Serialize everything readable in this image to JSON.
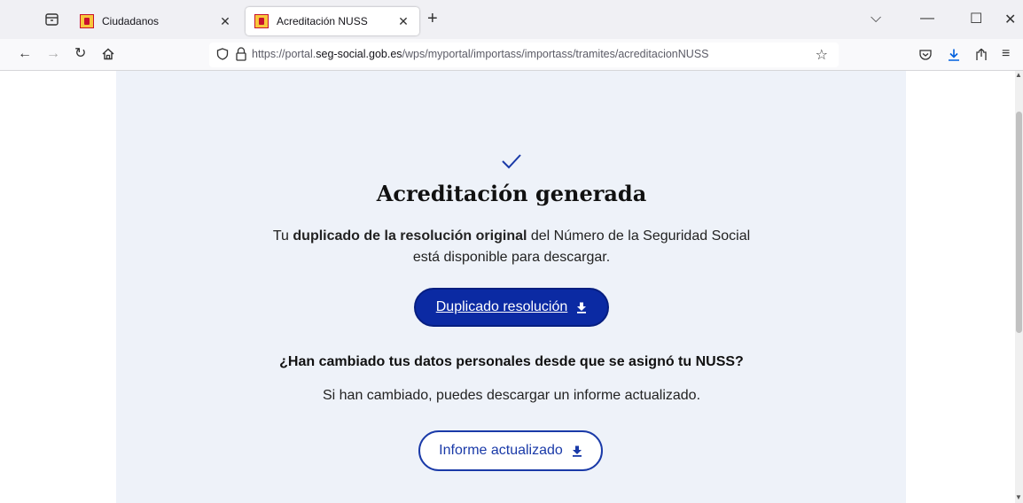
{
  "browser": {
    "tabs": [
      {
        "label": "Ciudadanos",
        "active": false
      },
      {
        "label": "Acreditación NUSS",
        "active": true
      }
    ],
    "url": {
      "prefix": "https://portal.",
      "host": "seg-social.gob.es",
      "path": "/wps/myportal/importass/importass/tramites/acreditacionNUSS"
    },
    "icons": {
      "tab_list": "tab-list-icon",
      "back": "back-arrow-icon",
      "forward": "forward-arrow-icon",
      "reload": "reload-icon",
      "home": "home-icon",
      "bookmark": "star-icon",
      "pocket": "pocket-icon",
      "downloads": "download-icon",
      "extensions": "share-icon",
      "menu": "hamburger-menu-icon"
    }
  },
  "page": {
    "heading": "Acreditación generada",
    "intro_prefix": "Tu ",
    "intro_bold": "duplicado de la resolución original",
    "intro_suffix": " del Número de la Seguridad Social está disponible para descargar.",
    "primary_button": "Duplicado resolución",
    "question": "¿Han cambiado tus datos personales desde que se asignó tu NUSS?",
    "info": "Si han cambiado, puedes descargar un informe actualizado.",
    "secondary_button": "Informe actualizado",
    "cutoff_text": ""
  },
  "colors": {
    "primary": "#0b2aa3",
    "panel_bg": "#eef2f9",
    "check": "#1a3aa8"
  }
}
